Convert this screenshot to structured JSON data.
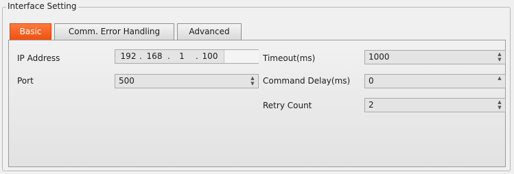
{
  "group": {
    "title": "Interface Setting"
  },
  "tabs": [
    {
      "label": "Basic",
      "active": true
    },
    {
      "label": "Comm. Error Handling",
      "active": false
    },
    {
      "label": "Advanced",
      "active": false
    }
  ],
  "left": {
    "ip_label": "IP Address",
    "ip": [
      "192",
      "168",
      "1",
      "100"
    ],
    "ip_separator": ".",
    "port_label": "Port",
    "port_value": "500"
  },
  "right": {
    "timeout_label": "Timeout(ms)",
    "timeout_value": "1000",
    "cmd_delay_label": "Command Delay(ms)",
    "cmd_delay_value": "0",
    "retry_label": "Retry Count",
    "retry_value": "2"
  },
  "icons": {
    "spin_up": "▲",
    "spin_down": "▼"
  },
  "colors": {
    "active_tab": "#f0500f",
    "field_bg": "#e4e4e4"
  }
}
